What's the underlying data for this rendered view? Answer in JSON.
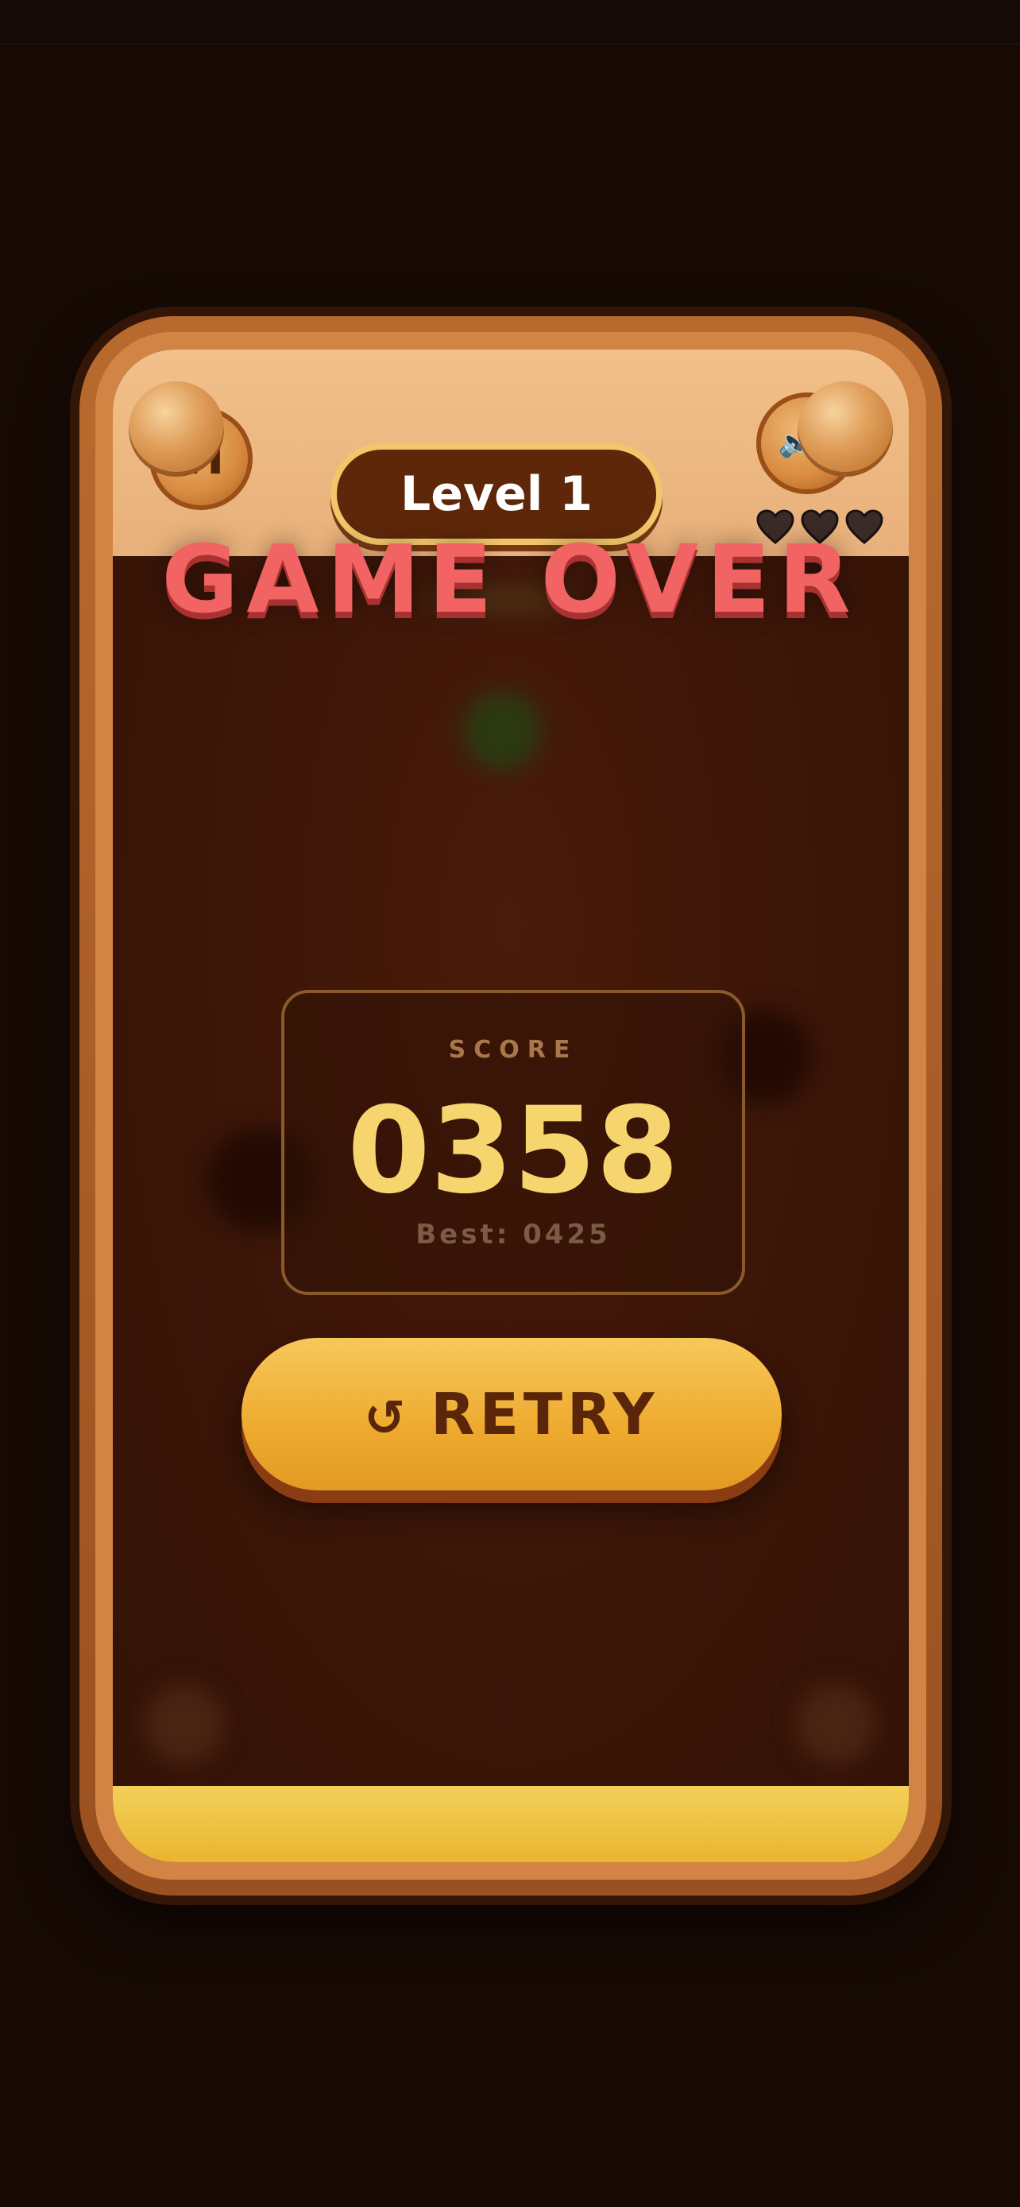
{
  "header": {
    "level_label": "Level 1",
    "pause_icon": "pause-icon",
    "sound_icon": "speaker-icon",
    "lives": 3,
    "life_icon": "heart-icon"
  },
  "overlay": {
    "title": "GAME OVER",
    "score_label": "SCORE",
    "score_value": "0358",
    "best_label": "Best: 0425",
    "retry_icon": "↺",
    "retry_label": "RETRY"
  },
  "colors": {
    "title": "#f26363",
    "score": "#f6d46e",
    "button": "#eeaa2f",
    "frame": "#b86a2e"
  }
}
